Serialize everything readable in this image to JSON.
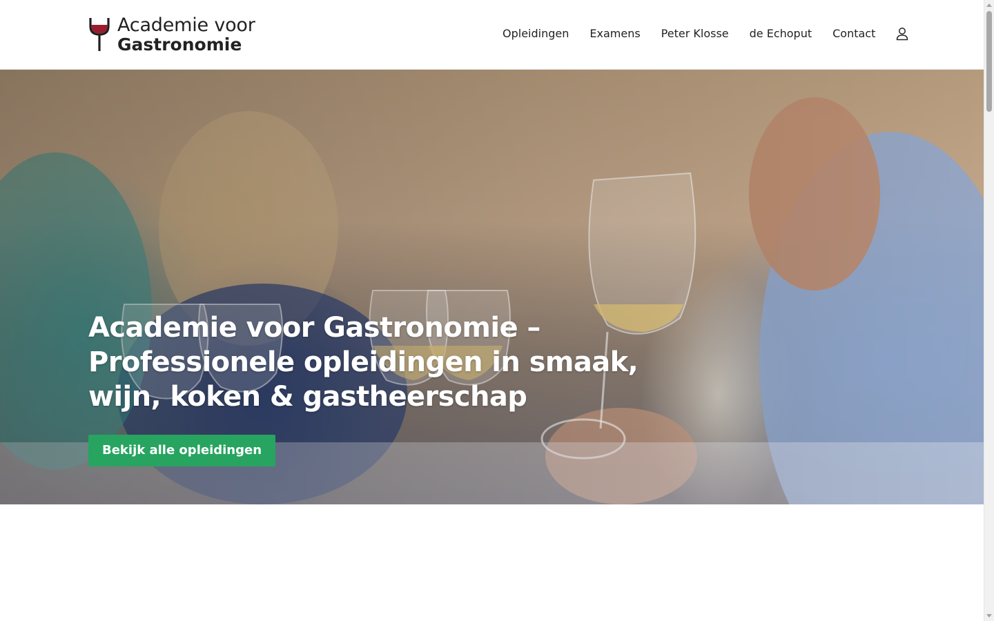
{
  "header": {
    "logo": {
      "line1": "Academie voor",
      "line2": "Gastronomie",
      "wine_color": "#9b1c2e"
    },
    "nav": [
      {
        "label": "Opleidingen"
      },
      {
        "label": "Examens"
      },
      {
        "label": "Peter Klosse"
      },
      {
        "label": "de Echoput"
      },
      {
        "label": "Contact"
      }
    ],
    "account_icon": "user-icon"
  },
  "hero": {
    "title": "Academie voor Gastronomie – Professionele opleidingen in smaak, wijn, koken & gastheerschap",
    "button_label": "Bekijk alle opleidingen",
    "button_color": "#27a460",
    "image_subject": "wine tasting class"
  }
}
